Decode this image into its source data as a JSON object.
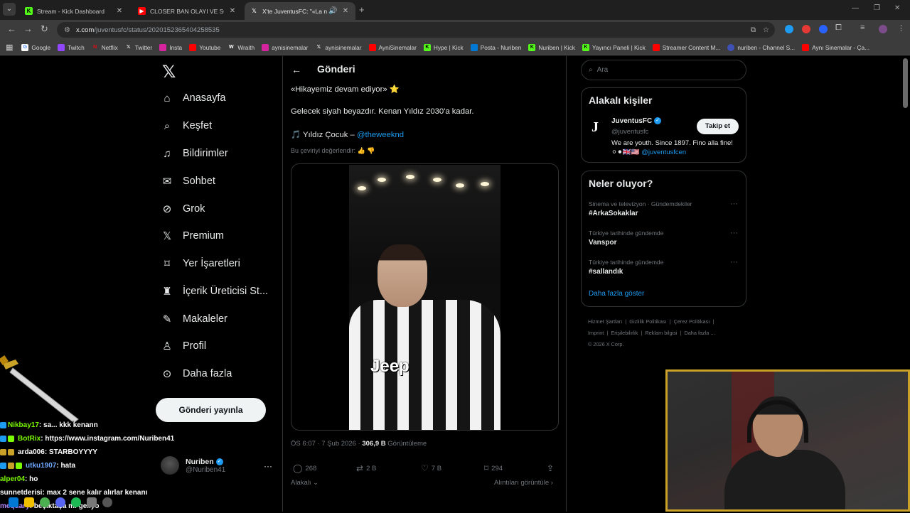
{
  "browser": {
    "tabs": [
      {
        "title": "Stream - Kick Dashboard",
        "favicon": "kick-icon",
        "active": false
      },
      {
        "title": "CLOSER BAN OLAYI VE SONRA",
        "favicon": "youtube-icon",
        "active": false
      },
      {
        "title": "X'te JuventusFC: \"«La nostr",
        "favicon": "x-icon",
        "active": true
      }
    ],
    "url_host": "x.com",
    "url_path": "/juventusfc/status/2020152365404258535",
    "bookmarks": [
      "Google",
      "Twitch",
      "Netflix",
      "Twitter",
      "Insta",
      "Youtube",
      "Wraith",
      "aynisinemalar",
      "aynisinemalar",
      "AyniSinemalar",
      "Hype | Kick",
      "Posta - Nuriben",
      "Nuriben | Kick",
      "Yayıncı Paneli | Kick",
      "Streamer Content M...",
      "nuriben - Channel S...",
      "Aynı Sinemalar - Ça..."
    ]
  },
  "sidebar": {
    "items": [
      {
        "label": "Anasayfa",
        "icon": "home-icon"
      },
      {
        "label": "Keşfet",
        "icon": "search-icon"
      },
      {
        "label": "Bildirimler",
        "icon": "bell-icon"
      },
      {
        "label": "Sohbet",
        "icon": "mail-icon"
      },
      {
        "label": "Grok",
        "icon": "grok-icon"
      },
      {
        "label": "Premium",
        "icon": "x-icon"
      },
      {
        "label": "Yer İşaretleri",
        "icon": "bookmark-icon"
      },
      {
        "label": "İçerik Üreticisi St...",
        "icon": "creator-icon"
      },
      {
        "label": "Makaleler",
        "icon": "article-icon"
      },
      {
        "label": "Profil",
        "icon": "person-icon"
      },
      {
        "label": "Daha fazla",
        "icon": "more-circle-icon"
      }
    ],
    "post_button": "Gönderi yayınla",
    "account": {
      "name": "Nuriben",
      "handle": "@Nuriben41"
    }
  },
  "post": {
    "header": "Gönderi",
    "line1": "«Hikayemiz devam ediyor» ⭐",
    "line2": "Gelecek siyah beyazdır. Kenan Yıldız 2030'a kadar.",
    "line3_prefix": "🎵 Yıldız Çocuk – ",
    "line3_mention": "@theweeknd",
    "rate_translation": "Bu çeviriyi değerlendir:",
    "time": "ÖS 6:07 · 7 Şub 2026 · ",
    "views": "306,9 B",
    "views_label": "Görüntüleme",
    "stats": {
      "replies": "268",
      "reposts": "2 B",
      "likes": "7 B",
      "bookmarks": "294"
    },
    "related_label": "Alakalı",
    "quotes_label": "Alıntıları görüntüle"
  },
  "right": {
    "search_placeholder": "Ara",
    "people_title": "Alakalı kişiler",
    "person": {
      "name": "JuventusFC",
      "handle": "@juventusfc",
      "bio": "We are youth. Since 1897. Fino alla fine! ⚪⚫🇬🇧🇺🇸",
      "bio_mention": "@juventusfcen",
      "follow": "Takip et"
    },
    "trends_title": "Neler oluyor?",
    "trends": [
      {
        "context": "Sinema ve televizyon · Gündemdekiler",
        "topic": "#ArkaSokaklar"
      },
      {
        "context": "Türkiye tarihinde gündemde",
        "topic": "Vanspor"
      },
      {
        "context": "Türkiye tarihinde gündemde",
        "topic": "#sallandık"
      }
    ],
    "show_more": "Daha fazla göster",
    "footer": [
      "Hizmet Şartları",
      "Gizlilik Politikası",
      "Çerez Politikası",
      "Imprint",
      "Erişilebilirlik",
      "Reklam bilgisi",
      "Daha fazla ...",
      "© 2026 X Corp."
    ]
  },
  "chat": [
    {
      "user": "Nikbay17",
      "msg": " : sa... kkk kenann",
      "color": "#7cfc00"
    },
    {
      "user": "BotRix",
      "msg": " : https://www.instagram.com/Nuriben41",
      "color": "#7cfc00"
    },
    {
      "user": "arda006",
      "msg": " : STARBOYYYY",
      "color": "#ffffff"
    },
    {
      "user": "utku1907",
      "msg": " : hata",
      "color": "#6fa8ff"
    },
    {
      "user": "alper04",
      "msg": " : ho",
      "color": "#7cfc00"
    },
    {
      "user": "sunnetderisi",
      "msg": " : max 2 sene kalır alırlar kenanı",
      "color": "#ffffff"
    },
    {
      "user": "mequary",
      "msg": " : beşiktaşa mı geliyo",
      "color": "#b388ff"
    }
  ],
  "colors": {
    "accent": "#1d9bf0",
    "bg": "#000000",
    "border": "#2f3336",
    "muted": "#71767b",
    "cam_border": "#c9a227"
  }
}
